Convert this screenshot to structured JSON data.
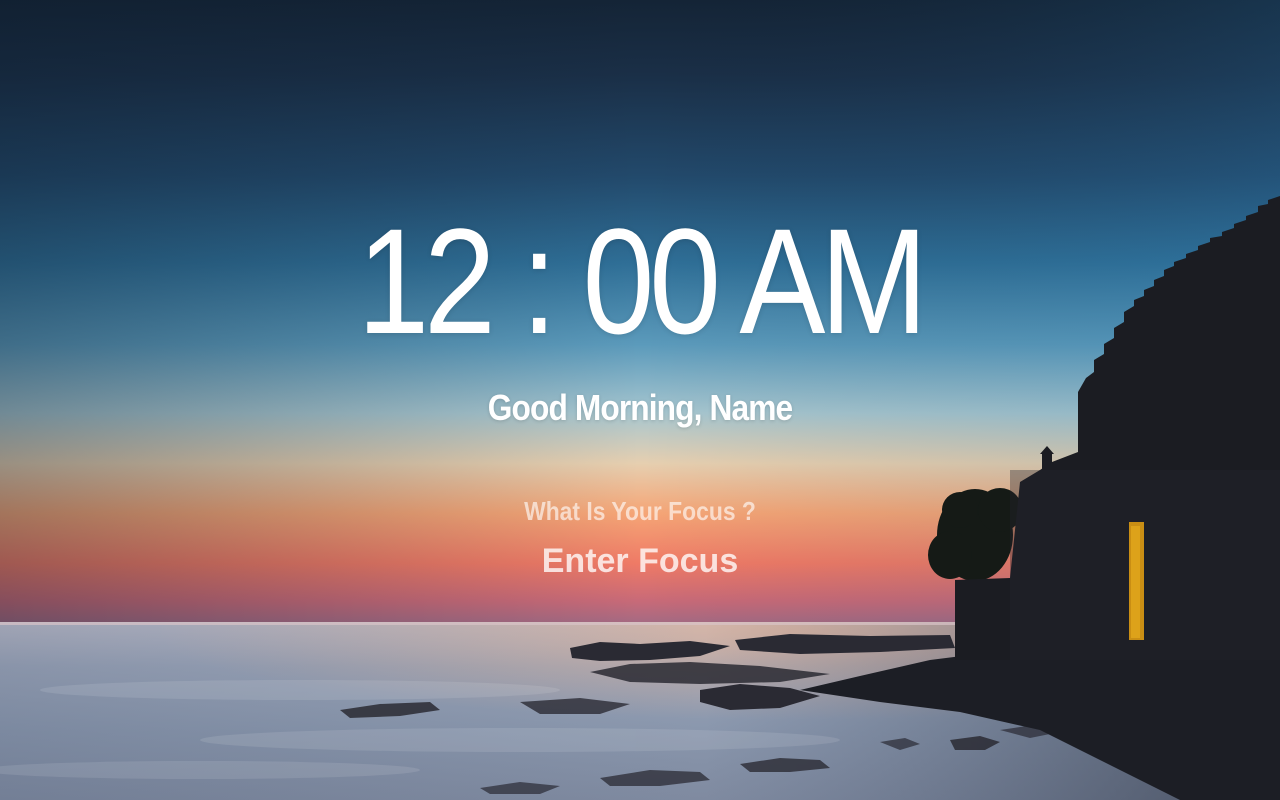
{
  "clock": {
    "time": "12 : 00 AM"
  },
  "greeting": {
    "text": "Good Morning, Name"
  },
  "focus": {
    "question": "What Is Your Focus ?",
    "placeholder": "Enter Focus",
    "value": ""
  },
  "background": {
    "sky_top": "#14273c",
    "sky_mid": "#2e6f9c",
    "horizon_glow": "#f59a6a",
    "sea": "#8a9bb2",
    "silhouette": "#15181e"
  }
}
